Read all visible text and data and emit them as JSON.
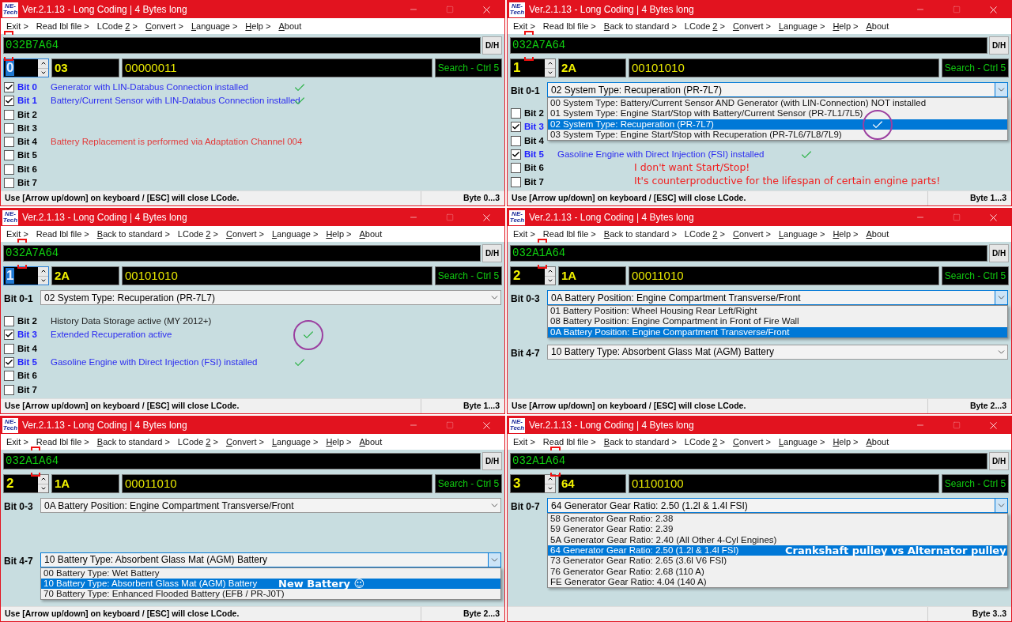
{
  "windows": [
    {
      "logo": [
        "NE-",
        "Tech"
      ],
      "title": "Ver.2.1.13 - Long Coding | 4 Bytes long",
      "menu": [
        {
          "label": "Exit >"
        },
        {
          "label": "Read lbl file >"
        },
        {
          "before": "LCode ",
          "key": "2",
          "after": " >"
        },
        {
          "key": "C",
          "after": "onvert >"
        },
        {
          "key": "L",
          "after": "anguage >"
        },
        {
          "key": "H",
          "after": "elp >"
        },
        {
          "key": "A",
          "after": "bout"
        }
      ],
      "code": "032B7A64",
      "dh_button": "D/H",
      "byte": {
        "value": "0",
        "selected": true
      },
      "hex": "03",
      "binary": "00000011",
      "search": "Search - Ctrl 5",
      "items": [
        {
          "kind": "bit",
          "label": "Bit 0",
          "checked": true,
          "description": "Generator with LIN-Databus Connection installed",
          "warning": false,
          "tick": true,
          "circled": false
        },
        {
          "kind": "bit",
          "label": "Bit 1",
          "checked": true,
          "description": "Battery/Current Sensor with LIN-Databus Connection installed",
          "warning": false,
          "tick": true,
          "circled": false
        },
        {
          "kind": "bit",
          "label": "Bit 2",
          "checked": false,
          "tick": false
        },
        {
          "kind": "bit",
          "label": "Bit 3",
          "checked": false,
          "tick": false
        },
        {
          "kind": "bit",
          "label": "Bit 4",
          "checked": false,
          "description": "Battery Replacement is performed via Adaptation Channel 004",
          "warning": true,
          "tick": false
        },
        {
          "kind": "bit",
          "label": "Bit 5",
          "checked": false,
          "tick": false
        },
        {
          "kind": "bit",
          "label": "Bit 6",
          "checked": false,
          "tick": false
        },
        {
          "kind": "bit",
          "label": "Bit 7",
          "checked": false,
          "tick": false
        }
      ],
      "status": {
        "hint": "Use [Arrow up/down] on keyboard / [ESC] will close LCode.",
        "range": "Byte 0...3"
      }
    },
    {
      "logo": [
        "NE-",
        "Tech"
      ],
      "title": "Ver.2.1.13 - Long Coding | 4 Bytes long",
      "menu": [
        {
          "label": "Exit >"
        },
        {
          "label": "Read lbl file >"
        },
        {
          "key": "B",
          "after": "ack to standard >"
        },
        {
          "before": "LCode ",
          "key": "2",
          "after": " >"
        },
        {
          "key": "C",
          "after": "onvert >"
        },
        {
          "key": "L",
          "after": "anguage >"
        },
        {
          "key": "H",
          "after": "elp >"
        },
        {
          "key": "A",
          "after": "bout"
        }
      ],
      "code": "032A7A64",
      "dh_button": "D/H",
      "byte": {
        "value": "1",
        "selected": false
      },
      "hex": "2A",
      "binary": "00101010",
      "search": "Search - Ctrl 5",
      "items": [
        {
          "kind": "select",
          "label": "Bit 0-1",
          "value": "02 System Type: Recuperation (PR-7L7)",
          "expanded": true,
          "options": [
            {
              "text": "00 System Type: Battery/Current Sensor AND Generator (with LIN-Connection) NOT installed",
              "selected": false,
              "tick": false
            },
            {
              "text": "01 System Type: Engine Start/Stop with Battery/Current Sensor (PR-7L1/7L5)",
              "selected": false,
              "tick": false
            },
            {
              "text": "02 System Type: Recuperation (PR-7L7)",
              "selected": true,
              "tick": true,
              "circled": true
            },
            {
              "text": "03 System Type: Engine Start/Stop with Recuperation (PR-7L6/7L8/7L9)",
              "selected": false,
              "tick": false
            }
          ]
        },
        {
          "kind": "bit",
          "label": "Bit 2",
          "checked": false,
          "tick": false
        },
        {
          "kind": "bit",
          "label": "Bit 3",
          "checked": true,
          "tick": false
        },
        {
          "kind": "bit",
          "label": "Bit 4",
          "checked": false,
          "tick": false
        },
        {
          "kind": "bit",
          "label": "Bit 5",
          "checked": true,
          "description": "Gasoline Engine with Direct Injection (FSI) installed",
          "warning": false,
          "tick": true,
          "circled": false
        },
        {
          "kind": "bit",
          "label": "Bit 6",
          "checked": false,
          "tick": false
        },
        {
          "kind": "bit",
          "label": "Bit 7",
          "checked": false,
          "tick": false
        }
      ],
      "remarks": [
        "I don't want Start/Stop!",
        "It's counterproductive for the lifespan of certain engine parts!"
      ],
      "status": {
        "hint": "Use [Arrow up/down] on keyboard / [ESC] will close LCode.",
        "range": "Byte 1...3"
      }
    },
    {
      "logo": [
        "NE-",
        "Tech"
      ],
      "title": "Ver.2.1.13 - Long Coding | 4 Bytes long",
      "menu": [
        {
          "label": "Exit >"
        },
        {
          "label": "Read lbl file >"
        },
        {
          "key": "B",
          "after": "ack to standard >"
        },
        {
          "before": "LCode ",
          "key": "2",
          "after": " >"
        },
        {
          "key": "C",
          "after": "onvert >"
        },
        {
          "key": "L",
          "after": "anguage >"
        },
        {
          "key": "H",
          "after": "elp >"
        },
        {
          "key": "A",
          "after": "bout"
        }
      ],
      "code": "032A7A64",
      "dh_button": "D/H",
      "byte": {
        "value": "1",
        "selected": true
      },
      "hex": "2A",
      "binary": "00101010",
      "search": "Search - Ctrl 5",
      "items": [
        {
          "kind": "select",
          "label": "Bit 0-1",
          "value": "02 System Type: Recuperation (PR-7L7)",
          "expanded": false
        },
        {
          "kind": "bit",
          "label": "Bit 2",
          "checked": false,
          "description": "History Data Storage active (MY 2012+)",
          "warning": false,
          "tick": false
        },
        {
          "kind": "bit",
          "label": "Bit 3",
          "checked": true,
          "description": "Extended Recuperation active",
          "warning": false,
          "tick": true,
          "circled": true
        },
        {
          "kind": "bit",
          "label": "Bit 4",
          "checked": false,
          "tick": false
        },
        {
          "kind": "bit",
          "label": "Bit 5",
          "checked": true,
          "description": "Gasoline Engine with Direct Injection (FSI) installed",
          "warning": false,
          "tick": true,
          "circled": false
        },
        {
          "kind": "bit",
          "label": "Bit 6",
          "checked": false,
          "tick": false
        },
        {
          "kind": "bit",
          "label": "Bit 7",
          "checked": false,
          "tick": false
        }
      ],
      "status": {
        "hint": "Use [Arrow up/down] on keyboard / [ESC] will close LCode.",
        "range": "Byte 1...3"
      }
    },
    {
      "logo": [
        "NE-",
        "Tech"
      ],
      "title": "Ver.2.1.13 - Long Coding | 4 Bytes long",
      "menu": [
        {
          "label": "Exit >"
        },
        {
          "label": "Read lbl file >"
        },
        {
          "key": "B",
          "after": "ack to standard >"
        },
        {
          "before": "LCode ",
          "key": "2",
          "after": " >"
        },
        {
          "key": "C",
          "after": "onvert >"
        },
        {
          "key": "L",
          "after": "anguage >"
        },
        {
          "key": "H",
          "after": "elp >"
        },
        {
          "key": "A",
          "after": "bout"
        }
      ],
      "code": "032A1A64",
      "dh_button": "D/H",
      "byte": {
        "value": "2",
        "selected": false
      },
      "hex": "1A",
      "binary": "00011010",
      "search": "Search - Ctrl 5",
      "items": [
        {
          "kind": "select",
          "label": "Bit 0-3",
          "value": "0A Battery Position: Engine Compartment Transverse/Front",
          "expanded": true,
          "options": [
            {
              "text": "01 Battery Position: Wheel Housing Rear Left/Right",
              "selected": false
            },
            {
              "text": "08 Battery Position: Engine Compartment in Front of Fire Wall",
              "selected": false
            },
            {
              "text": "0A Battery Position: Engine Compartment Transverse/Front",
              "selected": true
            }
          ]
        },
        {
          "kind": "select",
          "label": "Bit 4-7",
          "value": "10 Battery Type: Absorbent Glass Mat (AGM) Battery",
          "expanded": false
        }
      ],
      "status": {
        "hint": "Use [Arrow up/down] on keyboard / [ESC] will close LCode.",
        "range": "Byte 2...3"
      }
    },
    {
      "logo": [
        "NE-",
        "Tech"
      ],
      "title": "Ver.2.1.13 - Long Coding | 4 Bytes long",
      "menu": [
        {
          "label": "Exit >"
        },
        {
          "label": "Read lbl file >"
        },
        {
          "key": "B",
          "after": "ack to standard >"
        },
        {
          "before": "LCode ",
          "key": "2",
          "after": " >"
        },
        {
          "key": "C",
          "after": "onvert >"
        },
        {
          "key": "L",
          "after": "anguage >"
        },
        {
          "key": "H",
          "after": "elp >"
        },
        {
          "key": "A",
          "after": "bout"
        }
      ],
      "code": "032A1A64",
      "dh_button": "D/H",
      "byte": {
        "value": "2",
        "selected": false
      },
      "hex": "1A",
      "binary": "00011010",
      "search": "Search - Ctrl 5",
      "items": [
        {
          "kind": "select",
          "label": "Bit 0-3",
          "value": "0A Battery Position: Engine Compartment Transverse/Front",
          "expanded": false
        },
        {
          "kind": "select",
          "label": "Bit 4-7",
          "value": "10 Battery Type: Absorbent Glass Mat (AGM) Battery",
          "expanded": true,
          "options": [
            {
              "text": "00 Battery Type: Wet Battery",
              "selected": false
            },
            {
              "text": "10 Battery Type: Absorbent Glass Mat (AGM) Battery",
              "selected": true,
              "note": "New Battery ☺"
            },
            {
              "text": "70 Battery Type: Enhanced Flooded Battery (EFB / PR-J0T)",
              "selected": false
            }
          ]
        }
      ],
      "status": {
        "hint": "Use [Arrow up/down] on keyboard / [ESC] will close LCode.",
        "range": "Byte 2...3"
      }
    },
    {
      "logo": [
        "NE-",
        "Tech"
      ],
      "title": "Ver.2.1.13 - Long Coding | 4 Bytes long",
      "menu": [
        {
          "label": "Exit >"
        },
        {
          "label": "Read lbl file >"
        },
        {
          "key": "B",
          "after": "ack to standard >"
        },
        {
          "before": "LCode ",
          "key": "2",
          "after": " >"
        },
        {
          "key": "C",
          "after": "onvert >"
        },
        {
          "key": "L",
          "after": "anguage >"
        },
        {
          "key": "H",
          "after": "elp >"
        },
        {
          "key": "A",
          "after": "bout"
        }
      ],
      "code": "032A1A64",
      "dh_button": "D/H",
      "byte": {
        "value": "3",
        "selected": false
      },
      "hex": "64",
      "binary": "01100100",
      "search": "Search - Ctrl 5",
      "items": [
        {
          "kind": "select",
          "label": "Bit 0-7",
          "value": "64 Generator Gear Ratio: 2.50 (1.2l & 1.4l FSI)",
          "expanded": true,
          "options": [
            {
              "text": "58 Generator Gear Ratio: 2.38",
              "selected": false
            },
            {
              "text": "59 Generator Gear Ratio: 2.39",
              "selected": false
            },
            {
              "text": "5A Generator Gear Ratio: 2.40 (All Other 4-Cyl Engines)",
              "selected": false
            },
            {
              "text": "64 Generator Gear Ratio: 2.50 (1.2l & 1.4l FSI)",
              "selected": true,
              "note": "Crankshaft pulley vs Alternator pulley"
            },
            {
              "text": "73 Generator Gear Ratio: 2.65 (3.6l V6 FSI)",
              "selected": false
            },
            {
              "text": "76 Generator Gear Ratio: 2.68 (110 A)",
              "selected": false
            },
            {
              "text": "FE Generator Gear Ratio: 4.04 (140 A)",
              "selected": false
            }
          ]
        }
      ],
      "status": {
        "range": "Byte 3..3"
      }
    }
  ]
}
